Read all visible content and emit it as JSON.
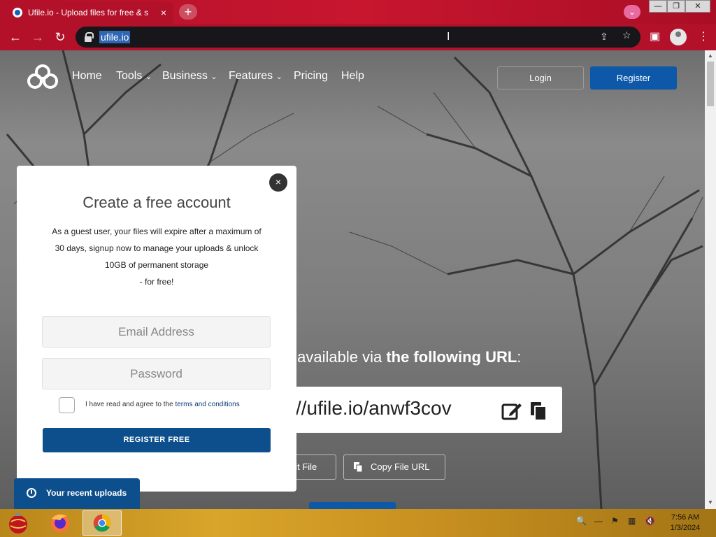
{
  "browser": {
    "tab_title": "Ufile.io - Upload files for free & s",
    "tab_close": "×",
    "new_tab": "+",
    "url": "ufile.io",
    "win_min": "—",
    "win_restore": "❐",
    "win_close": "✕"
  },
  "site": {
    "nav": [
      "Home",
      "Tools",
      "Business",
      "Features",
      "Pricing",
      "Help"
    ],
    "login": "Login",
    "register": "Register"
  },
  "upload": {
    "available_prefix": "s available via ",
    "available_bold": "the following URL",
    "available_suffix": ":",
    "file_url": "//ufile.io/anwf3cov",
    "edit_file": "dit File",
    "copy_file_url": "Copy File URL"
  },
  "modal": {
    "title": "Create a free account",
    "description_lines": [
      "As a guest user, your files will expire after a maximum of",
      "30 days, signup now to manage your uploads & unlock",
      "10GB of permanent storage",
      "- for free!"
    ],
    "email_placeholder": "Email Address",
    "password_placeholder": "Password",
    "agree_text": "I have read and agree to the ",
    "terms_link": "terms and conditions",
    "register_button": "REGISTER FREE",
    "close": "×"
  },
  "recent_uploads": "Your recent uploads",
  "taskbar": {
    "time": "7:56 AM",
    "date": "1/3/2024"
  },
  "colors": {
    "chrome_red": "#b3102a",
    "brand_blue": "#0d58a8",
    "modal_button": "#0d4f8c"
  }
}
